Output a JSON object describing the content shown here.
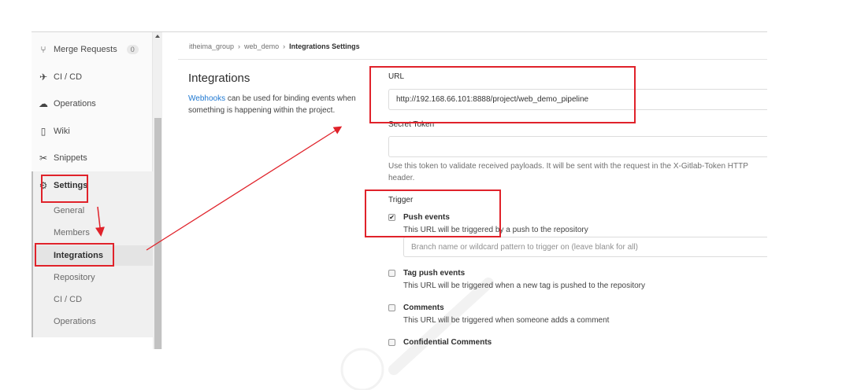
{
  "sidebar": {
    "items": [
      {
        "icon": "merge-request-icon",
        "glyph": "⑂",
        "label": "Merge Requests",
        "badge": "0"
      },
      {
        "icon": "rocket-icon",
        "glyph": "✈",
        "label": "CI / CD"
      },
      {
        "icon": "cloud-icon",
        "glyph": "☁",
        "label": "Operations"
      },
      {
        "icon": "book-icon",
        "glyph": "▯",
        "label": "Wiki"
      },
      {
        "icon": "scissors-icon",
        "glyph": "✂",
        "label": "Snippets"
      }
    ],
    "settings": {
      "icon": "gear-icon",
      "glyph": "⚙",
      "label": "Settings"
    },
    "sub_items": [
      "General",
      "Members",
      "Integrations",
      "Repository",
      "CI / CD",
      "Operations"
    ],
    "active_sub_item": "Integrations"
  },
  "breadcrumb": {
    "items": [
      "itheima_group",
      "web_demo"
    ],
    "separator": "›",
    "current": "Integrations Settings"
  },
  "main": {
    "title": "Integrations",
    "description_link": "Webhooks",
    "description_rest": " can be used for binding events when something is happening within the project."
  },
  "form": {
    "url_label": "URL",
    "url_value": "http://192.168.66.101:8888/project/web_demo_pipeline",
    "token_label": "Secret Token",
    "token_value": "",
    "token_help": "Use this token to validate received payloads. It will be sent with the request in the X-Gitlab-Token HTTP header.",
    "trigger_label": "Trigger",
    "triggers": [
      {
        "title": "Push events",
        "desc": "This URL will be triggered by a push to the repository",
        "checked": true
      },
      {
        "title": "Tag push events",
        "desc": "This URL will be triggered when a new tag is pushed to the repository",
        "checked": false
      },
      {
        "title": "Comments",
        "desc": "This URL will be triggered when someone adds a comment",
        "checked": false
      },
      {
        "title": "Confidential Comments",
        "desc": "",
        "checked": false
      }
    ],
    "branch_placeholder": "Branch name or wildcard pattern to trigger on (leave blank for all)"
  },
  "colors": {
    "annotation": "#e0222a",
    "link": "#1f78d1"
  }
}
